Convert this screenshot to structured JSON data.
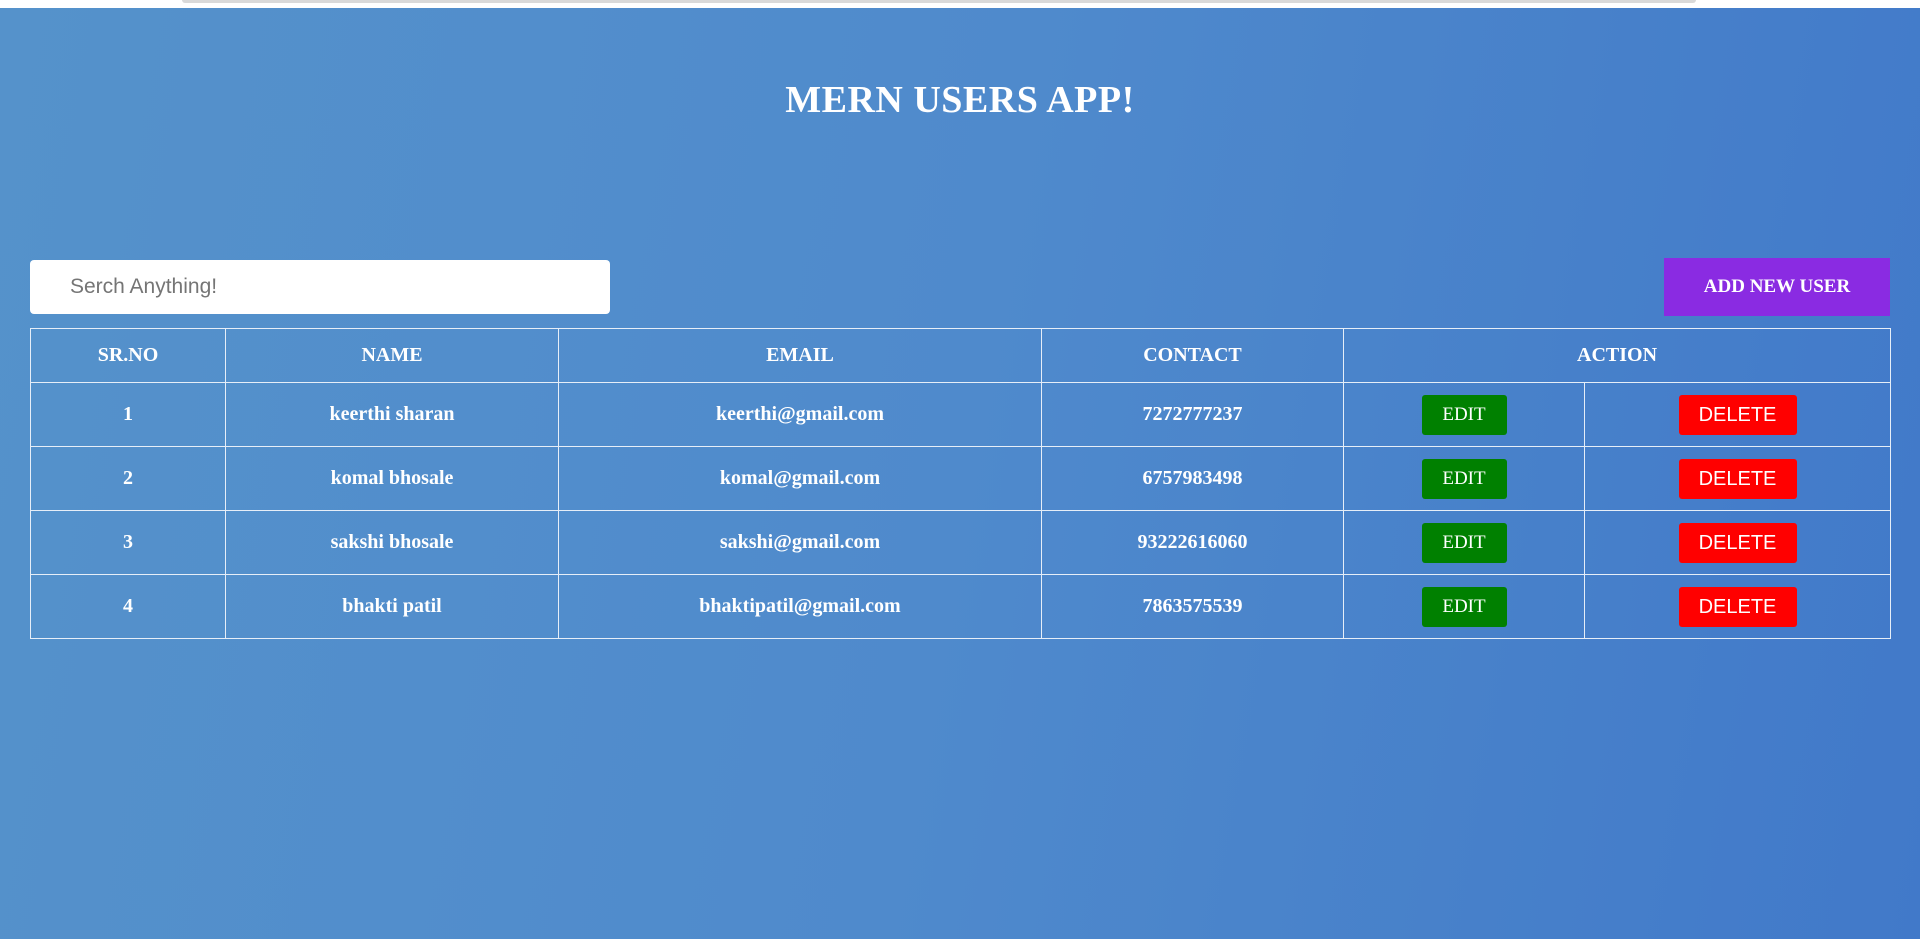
{
  "app": {
    "title": "MERN USERS APP!"
  },
  "toolbar": {
    "search_placeholder": "Serch Anything!",
    "search_value": "",
    "add_label": "ADD NEW USER"
  },
  "table": {
    "headers": {
      "sr": "SR.NO",
      "name": "NAME",
      "email": "EMAIL",
      "contact": "CONTACT",
      "action": "ACTION"
    },
    "rows": [
      {
        "sr": "1",
        "name": "keerthi sharan",
        "email": "keerthi@gmail.com",
        "contact": "7272777237",
        "edit": "EDIT",
        "delete": "DELETE"
      },
      {
        "sr": "2",
        "name": "komal bhosale",
        "email": "komal@gmail.com",
        "contact": "6757983498",
        "edit": "EDIT",
        "delete": "DELETE"
      },
      {
        "sr": "3",
        "name": "sakshi bhosale",
        "email": "sakshi@gmail.com",
        "contact": "93222616060",
        "edit": "EDIT",
        "delete": "DELETE"
      },
      {
        "sr": "4",
        "name": "bhakti patil",
        "email": "bhaktipatil@gmail.com",
        "contact": "7863575539",
        "edit": "EDIT",
        "delete": "DELETE"
      }
    ]
  },
  "colors": {
    "add_button": "#8a2be2",
    "edit_button": "#008000",
    "delete_button": "#ff0000",
    "background_start": "#5592cb",
    "background_end": "#4179c9"
  }
}
